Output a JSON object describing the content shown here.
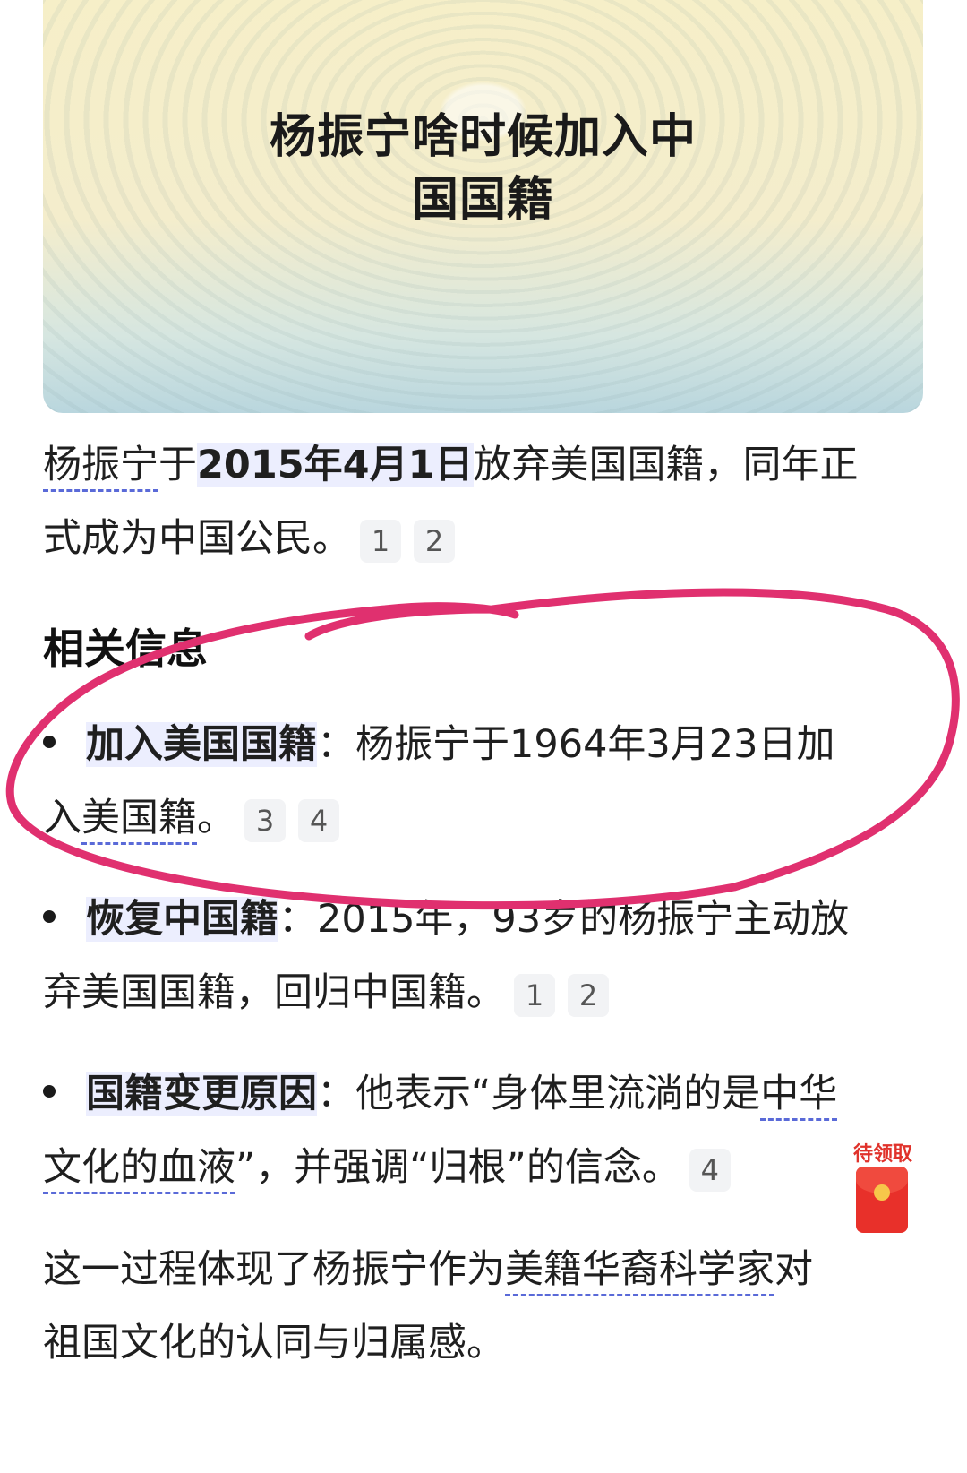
{
  "hero": {
    "title_line1": "杨振宁啥时候加入中",
    "title_line2": "国国籍"
  },
  "answer": {
    "name": "杨振宁",
    "mid1": "于",
    "date": "2015年4月1日",
    "text1": "放弃美国国籍，同年正",
    "text2": "式成为中国公民。",
    "cites": [
      "1",
      "2"
    ]
  },
  "related": {
    "title": "相关信息",
    "items": [
      {
        "term": "加入美国国籍",
        "colon": "：",
        "line1": "杨振宁于1964年3月23日加",
        "line2_a": "入",
        "line2_b": "美国籍",
        "line2_c": "。",
        "cites": [
          "3",
          "4"
        ]
      },
      {
        "term": "恢复中国籍",
        "colon": "：",
        "line1": "2015年，93岁的杨振宁主动放",
        "line2": "弃美国国籍，回归中国籍。",
        "cites": [
          "1",
          "2"
        ]
      },
      {
        "term": "国籍变更原因",
        "colon": "：",
        "line1_a": "他表示“身体里流淌的是",
        "line1_b": "中华",
        "line2_a": "文化的血液",
        "line2_b": "”，并强调“归根”的信念。",
        "cites": [
          "4"
        ]
      }
    ]
  },
  "conclusion": {
    "line1_a": "这一过程体现了杨振宁作为",
    "line1_b": "美籍华裔科学家",
    "line1_c": "对",
    "line2": "祖国文化的认同与归属感。"
  },
  "redpacket": {
    "label": "待领取"
  },
  "annotation": {
    "color": "#e0306f"
  }
}
